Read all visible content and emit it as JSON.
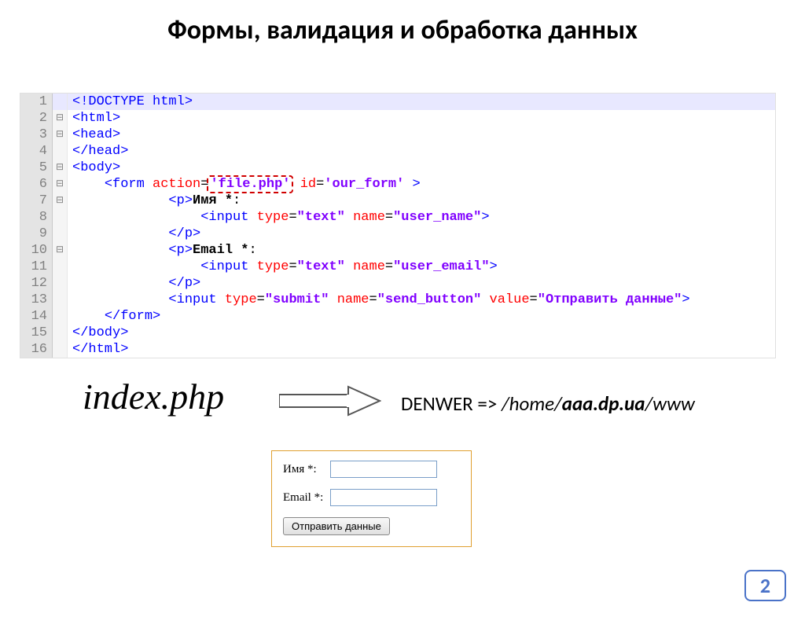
{
  "title": "Формы, валидация и обработка данных",
  "editor": {
    "lines": [
      {
        "n": "1",
        "fold": "",
        "hl": true,
        "tokens": [
          [
            "tag",
            "<!DOCTYPE html>"
          ]
        ]
      },
      {
        "n": "2",
        "fold": "⊟",
        "hl": false,
        "tokens": [
          [
            "tag",
            "<html>"
          ]
        ]
      },
      {
        "n": "3",
        "fold": "⊟",
        "hl": false,
        "tokens": [
          [
            "tag",
            "<head>"
          ]
        ]
      },
      {
        "n": "4",
        "fold": "",
        "hl": false,
        "tokens": [
          [
            "tag",
            "</head>"
          ]
        ]
      },
      {
        "n": "5",
        "fold": "⊟",
        "hl": false,
        "tokens": [
          [
            "tag",
            "<body>"
          ]
        ]
      },
      {
        "n": "6",
        "fold": "⊟",
        "hl": false,
        "tokens": [
          [
            "plain",
            "    "
          ],
          [
            "tag",
            "<form"
          ],
          [
            "plain",
            " "
          ],
          [
            "attr",
            "action"
          ],
          [
            "plain",
            "="
          ],
          [
            "dashval",
            "'file.php'"
          ],
          [
            "plain",
            " "
          ],
          [
            "attr",
            "id"
          ],
          [
            "plain",
            "="
          ],
          [
            "val",
            "'our_form'"
          ],
          [
            "plain",
            " "
          ],
          [
            "tag",
            ">"
          ]
        ]
      },
      {
        "n": "7",
        "fold": "⊟",
        "hl": false,
        "tokens": [
          [
            "plain",
            "            "
          ],
          [
            "tag",
            "<p>"
          ],
          [
            "txt",
            "Имя *"
          ],
          [
            "plain",
            ":"
          ]
        ]
      },
      {
        "n": "8",
        "fold": "",
        "hl": false,
        "tokens": [
          [
            "plain",
            "                "
          ],
          [
            "tag",
            "<input"
          ],
          [
            "plain",
            " "
          ],
          [
            "attr",
            "type"
          ],
          [
            "plain",
            "="
          ],
          [
            "val",
            "\"text\""
          ],
          [
            "plain",
            " "
          ],
          [
            "attr",
            "name"
          ],
          [
            "plain",
            "="
          ],
          [
            "val",
            "\"user_name\""
          ],
          [
            "tag",
            ">"
          ]
        ]
      },
      {
        "n": "9",
        "fold": "",
        "hl": false,
        "tokens": [
          [
            "plain",
            "            "
          ],
          [
            "tag",
            "</p>"
          ]
        ]
      },
      {
        "n": "10",
        "fold": "⊟",
        "hl": false,
        "tokens": [
          [
            "plain",
            "            "
          ],
          [
            "tag",
            "<p>"
          ],
          [
            "txt",
            "Email *"
          ],
          [
            "plain",
            ":"
          ]
        ]
      },
      {
        "n": "11",
        "fold": "",
        "hl": false,
        "tokens": [
          [
            "plain",
            "                "
          ],
          [
            "tag",
            "<input"
          ],
          [
            "plain",
            " "
          ],
          [
            "attr",
            "type"
          ],
          [
            "plain",
            "="
          ],
          [
            "val",
            "\"text\""
          ],
          [
            "plain",
            " "
          ],
          [
            "attr",
            "name"
          ],
          [
            "plain",
            "="
          ],
          [
            "val",
            "\"user_email\""
          ],
          [
            "tag",
            ">"
          ]
        ]
      },
      {
        "n": "12",
        "fold": "",
        "hl": false,
        "tokens": [
          [
            "plain",
            "            "
          ],
          [
            "tag",
            "</p>"
          ]
        ]
      },
      {
        "n": "13",
        "fold": "",
        "hl": false,
        "tokens": [
          [
            "plain",
            "            "
          ],
          [
            "tag",
            "<input"
          ],
          [
            "plain",
            " "
          ],
          [
            "attr",
            "type"
          ],
          [
            "plain",
            "="
          ],
          [
            "val",
            "\"submit\""
          ],
          [
            "plain",
            " "
          ],
          [
            "attr",
            "name"
          ],
          [
            "plain",
            "="
          ],
          [
            "val",
            "\"send_button\""
          ],
          [
            "plain",
            " "
          ],
          [
            "attr",
            "value"
          ],
          [
            "plain",
            "="
          ],
          [
            "val",
            "\"Отправить данные\""
          ],
          [
            "tag",
            ">"
          ]
        ]
      },
      {
        "n": "14",
        "fold": "",
        "hl": false,
        "tokens": [
          [
            "plain",
            "    "
          ],
          [
            "tag",
            "</form>"
          ]
        ]
      },
      {
        "n": "15",
        "fold": "",
        "hl": false,
        "tokens": [
          [
            "tag",
            "</body>"
          ]
        ]
      },
      {
        "n": "16",
        "fold": "",
        "hl": false,
        "tokens": [
          [
            "tag",
            "</html>"
          ]
        ]
      }
    ]
  },
  "filename": "index.php",
  "path": {
    "prefix": "DENWER => ",
    "pre_italic": "/home/",
    "bold_italic": "aaa.dp.ua",
    "post_italic": "/www"
  },
  "form_preview": {
    "name_label": "Имя *:",
    "email_label": "Email *:",
    "submit_label": "Отправить данные"
  },
  "page_number": "2"
}
